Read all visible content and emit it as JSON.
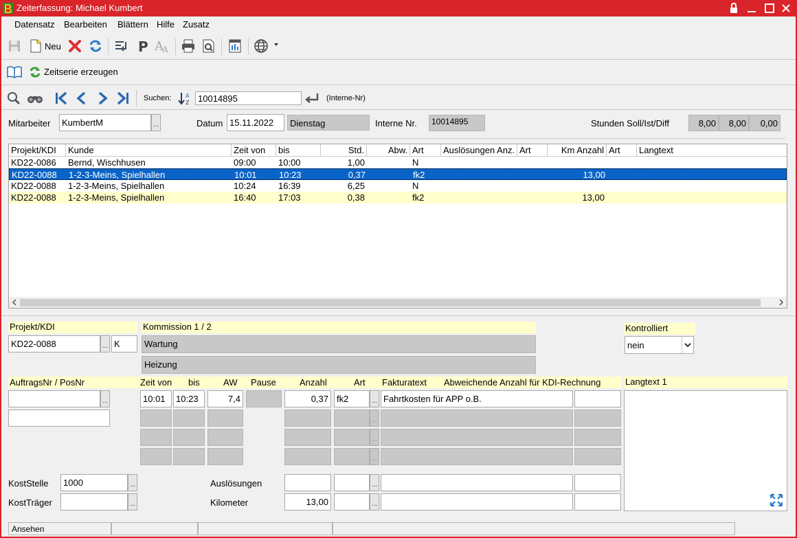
{
  "window": {
    "title": "Zeiterfassung: Michael Kumbert"
  },
  "menu": [
    "Datensatz",
    "Bearbeiten",
    "Blättern",
    "Hilfe",
    "Zusatz"
  ],
  "toolbar": {
    "new_label": "Neu"
  },
  "action": {
    "label": "Zeitserie erzeugen"
  },
  "search": {
    "label": "Suchen:",
    "value": "10014895",
    "hint": "(Interne-Nr)"
  },
  "header": {
    "employee_label": "Mitarbeiter",
    "employee_value": "KumbertM",
    "date_label": "Datum",
    "date_value": "15.11.2022",
    "weekday": "Dienstag",
    "internal_label": "Interne Nr.",
    "internal_value": "10014895",
    "hours_label": "Stunden Soll/Ist/Diff",
    "hours_soll": "8,00",
    "hours_ist": "8,00",
    "hours_diff": "0,00"
  },
  "grid": {
    "columns": [
      "Projekt/KDI",
      "Kunde",
      "Zeit von",
      "bis",
      "Std.",
      "Abw.",
      "Art",
      "Auslösungen Anz.",
      "Art",
      "Km Anzahl",
      "Art",
      "Langtext"
    ],
    "rows": [
      {
        "projekt": "KD22-0086",
        "kunde": "Bernd, Wischhusen",
        "von": "09:00",
        "bis": "10:00",
        "std": "1,00",
        "art": "N",
        "km": ""
      },
      {
        "projekt": "KD22-0088",
        "kunde": "1-2-3-Meins, Spielhallen",
        "von": "10:01",
        "bis": "10:23",
        "std": "0,37",
        "art": "fk2",
        "km": "13,00"
      },
      {
        "projekt": "KD22-0088",
        "kunde": "1-2-3-Meins, Spielhallen",
        "von": "10:24",
        "bis": "16:39",
        "std": "6,25",
        "art": "N",
        "km": ""
      },
      {
        "projekt": "KD22-0088",
        "kunde": "1-2-3-Meins, Spielhallen",
        "von": "16:40",
        "bis": "17:03",
        "std": "0,38",
        "art": "fk2",
        "km": "13,00"
      }
    ]
  },
  "detail": {
    "projekt_label": "Projekt/KDI",
    "projekt_value": "KD22-0088",
    "projekt_type": "K",
    "kommission_label": "Kommission 1 / 2",
    "kommission1": "Wartung",
    "kommission2": "Heizung",
    "kontrolliert_label": "Kontrolliert",
    "kontrolliert_value": "nein",
    "auftrag_label": "AuftragsNr / PosNr",
    "zeit_von_label": "Zeit von",
    "bis_label": "bis",
    "aw_label": "AW",
    "pause_label": "Pause",
    "anzahl_label": "Anzahl",
    "art_label": "Art",
    "fakturatext_label": "Fakturatext",
    "abweichend_label": "Abweichende Anzahl für KDI-Rechnung",
    "langtext_label": "Langtext 1",
    "zeit_von": "10:01",
    "bis": "10:23",
    "aw": "7,4",
    "anzahl": "0,37",
    "art": "fk2",
    "fakturatext": "Fahrtkosten für APP o.B.",
    "koststelle_label": "KostStelle",
    "koststelle_value": "1000",
    "kosttraeger_label": "KostTräger",
    "ausloesungen_label": "Auslösungen",
    "kilometer_label": "Kilometer",
    "kilometer_value": "13,00"
  },
  "status": {
    "mode": "Ansehen"
  },
  "colors": {
    "titlebar": "#d9242a",
    "selection": "#0a64c8",
    "highlight_row": "#ffffcc"
  }
}
